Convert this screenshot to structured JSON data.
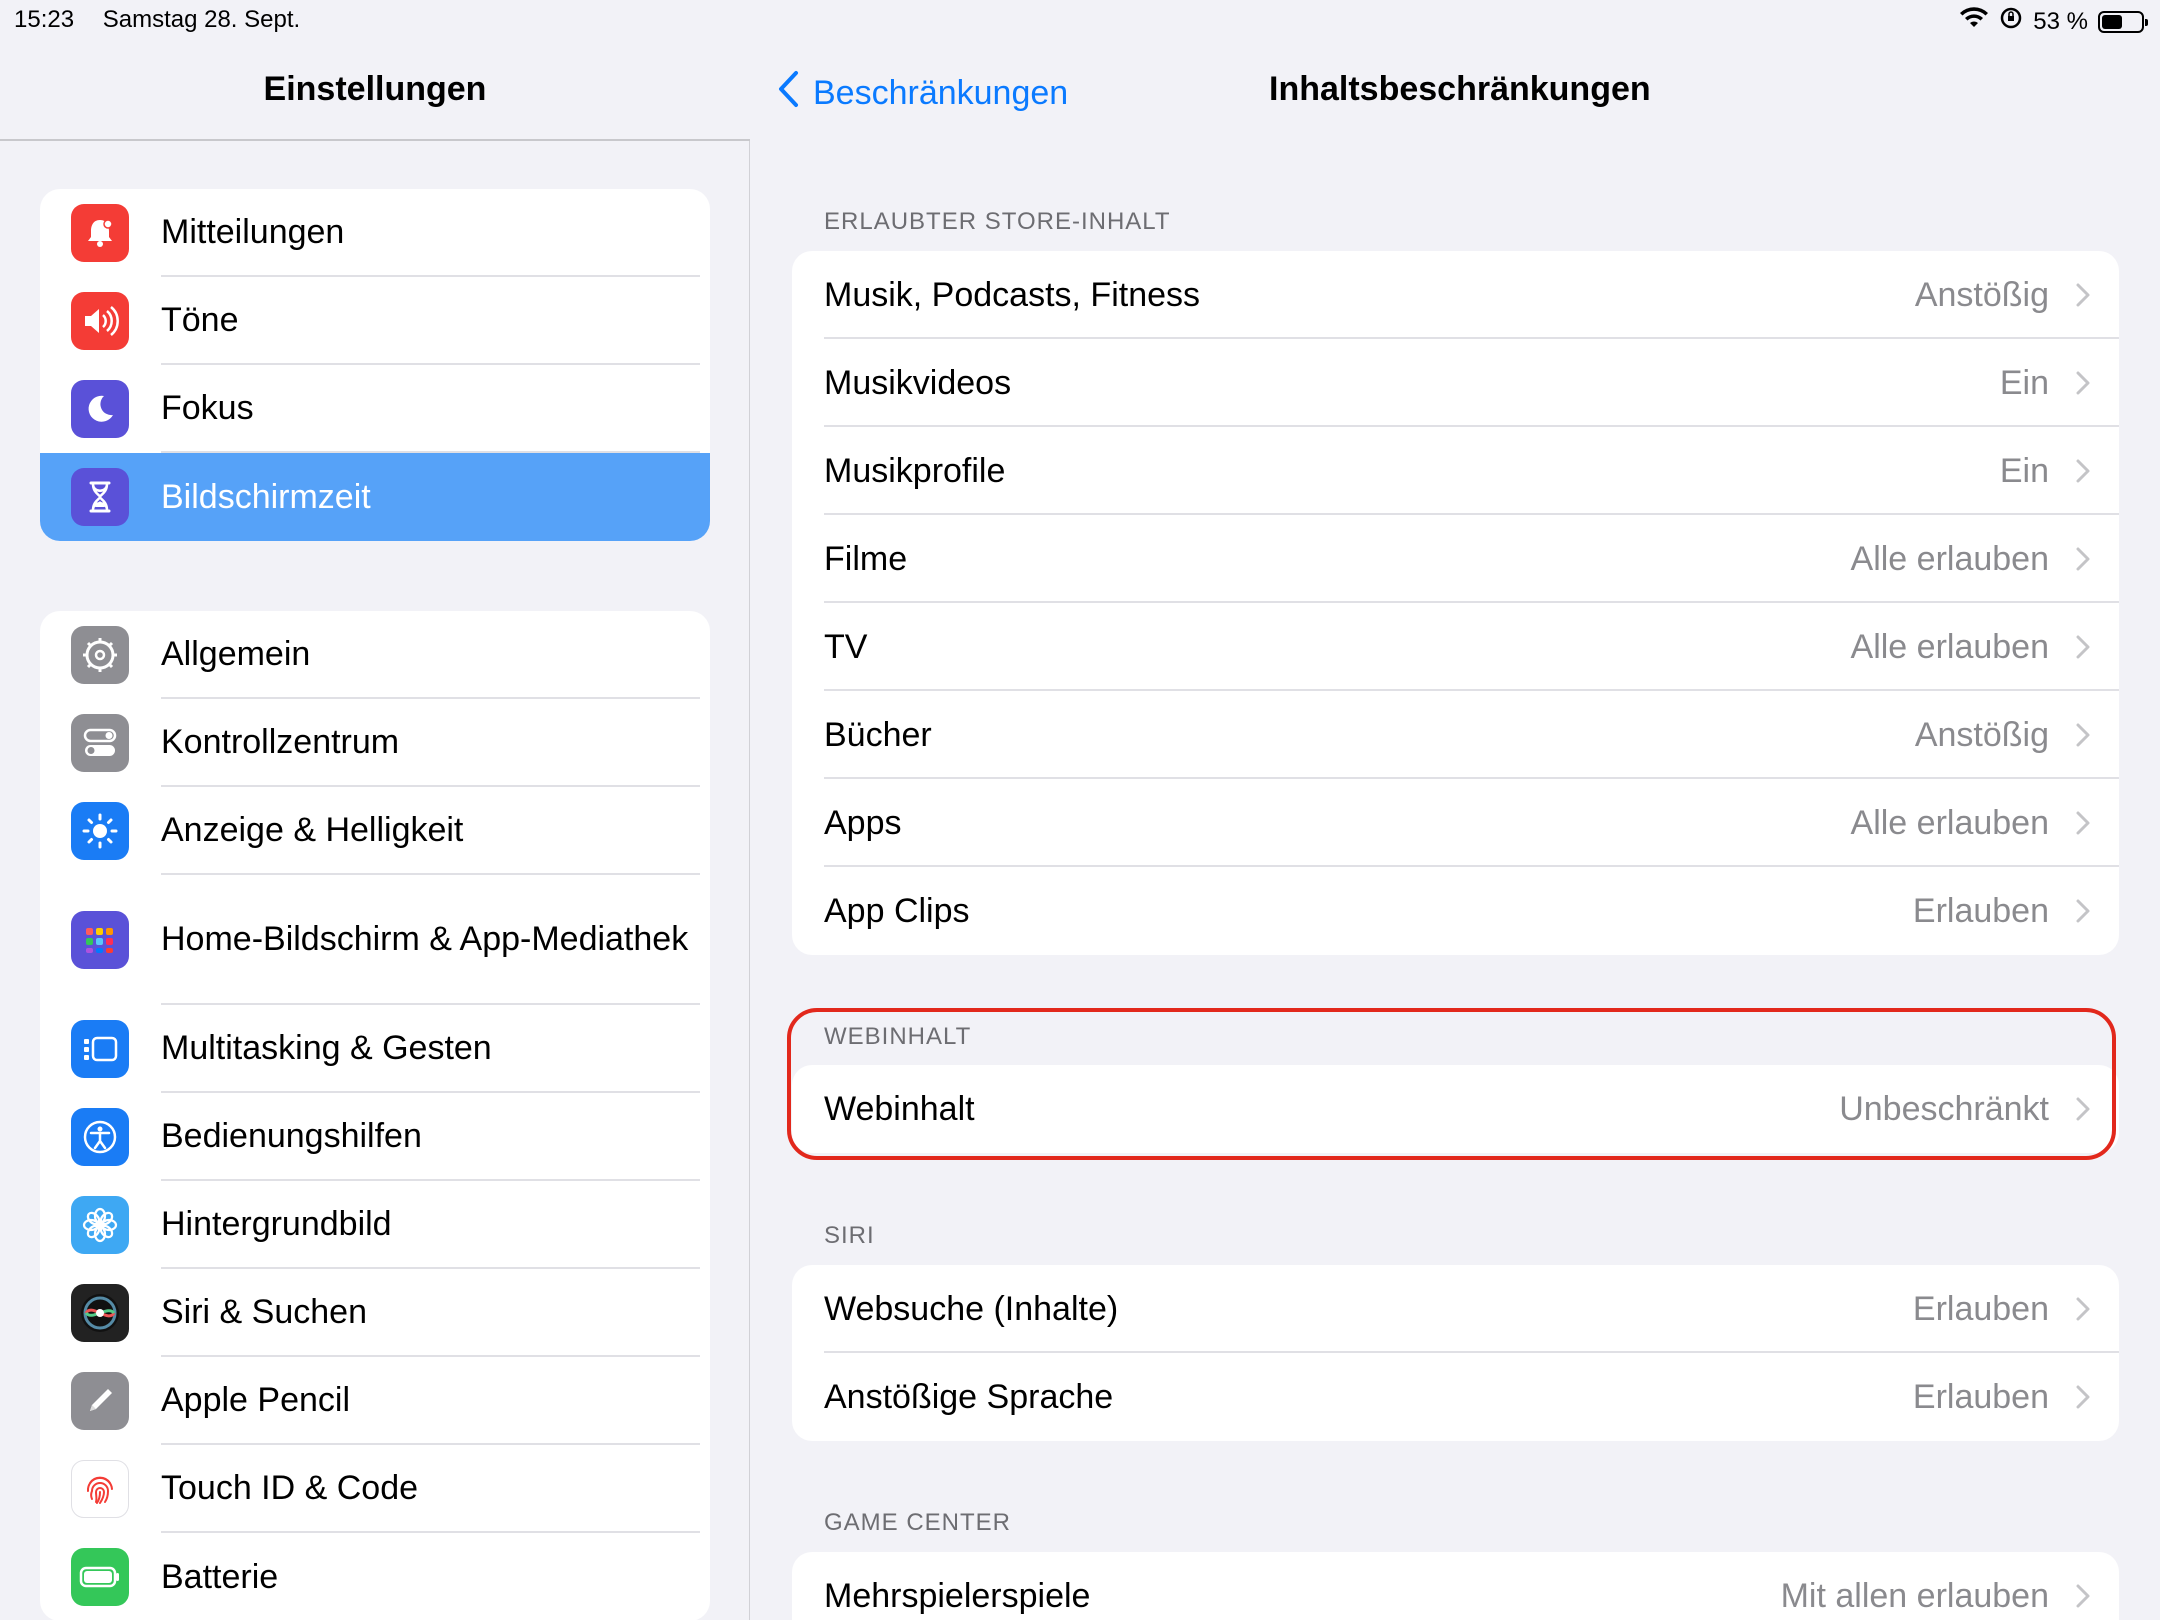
{
  "status_bar": {
    "time": "15:23",
    "date": "Samstag 28. Sept.",
    "battery_text": "53 %",
    "battery_level": 0.53
  },
  "sidebar": {
    "title": "Einstellungen",
    "group1": [
      {
        "label": "Mitteilungen",
        "icon": "bell-icon",
        "color": "#f43c36"
      },
      {
        "label": "Töne",
        "icon": "speaker-icon",
        "color": "#f43c36"
      },
      {
        "label": "Fokus",
        "icon": "moon-icon",
        "color": "#5a51d8"
      },
      {
        "label": "Bildschirmzeit",
        "icon": "hourglass-icon",
        "color": "#5a51d8",
        "selected": true
      }
    ],
    "group2": [
      {
        "label": "Allgemein",
        "icon": "gear-icon",
        "color": "#8e8e93"
      },
      {
        "label": "Kontrollzentrum",
        "icon": "toggles-icon",
        "color": "#8e8e93"
      },
      {
        "label": "Anzeige & Helligkeit",
        "icon": "sun-icon",
        "color": "#1a7cf5"
      },
      {
        "label": "Home-Bildschirm & App-Mediathek",
        "icon": "grid-icon",
        "color": "#5a51d8"
      },
      {
        "label": "Multitasking & Gesten",
        "icon": "multitask-icon",
        "color": "#1a7cf5"
      },
      {
        "label": "Bedienungshilfen",
        "icon": "accessibility-icon",
        "color": "#1a7cf5"
      },
      {
        "label": "Hintergrundbild",
        "icon": "flower-icon",
        "color": "#3ea8f3"
      },
      {
        "label": "Siri & Suchen",
        "icon": "siri-icon",
        "color": "#222"
      },
      {
        "label": "Apple Pencil",
        "icon": "pencil-icon",
        "color": "#8e8e93"
      },
      {
        "label": "Touch ID & Code",
        "icon": "fingerprint-icon",
        "color": "#ffffff"
      },
      {
        "label": "Batterie",
        "icon": "battery-icon",
        "color": "#34c759"
      }
    ]
  },
  "detail": {
    "back_label": "Beschränkungen",
    "title": "Inhaltsbeschränkungen",
    "sections": [
      {
        "header": "ERLAUBTER STORE-INHALT",
        "rows": [
          {
            "label": "Musik, Podcasts, Fitness",
            "value": "Anstößig"
          },
          {
            "label": "Musikvideos",
            "value": "Ein"
          },
          {
            "label": "Musikprofile",
            "value": "Ein"
          },
          {
            "label": "Filme",
            "value": "Alle erlauben"
          },
          {
            "label": "TV",
            "value": "Alle erlauben"
          },
          {
            "label": "Bücher",
            "value": "Anstößig"
          },
          {
            "label": "Apps",
            "value": "Alle erlauben"
          },
          {
            "label": "App Clips",
            "value": "Erlauben"
          }
        ]
      },
      {
        "header": "WEBINHALT",
        "rows": [
          {
            "label": "Webinhalt",
            "value": "Unbeschränkt"
          }
        ]
      },
      {
        "header": "SIRI",
        "rows": [
          {
            "label": "Websuche (Inhalte)",
            "value": "Erlauben"
          },
          {
            "label": "Anstößige Sprache",
            "value": "Erlauben"
          }
        ]
      },
      {
        "header": "GAME CENTER",
        "rows": [
          {
            "label": "Mehrspielerspiele",
            "value": "Mit allen erlauben"
          }
        ]
      }
    ]
  },
  "colors": {
    "accent": "#0a7aff",
    "selected_row": "#56a2f8",
    "highlight": "#e2281c"
  }
}
